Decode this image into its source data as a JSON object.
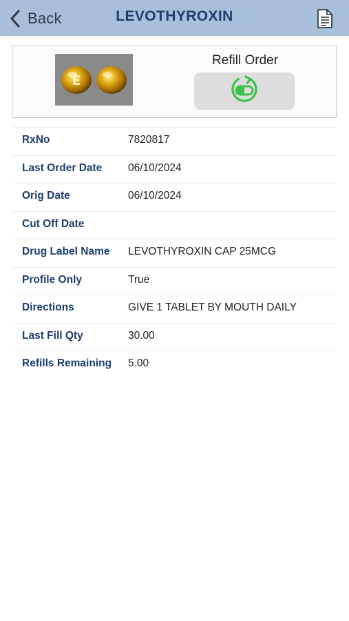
{
  "nav": {
    "back_label": "Back",
    "title": "LEVOTHYROXIN",
    "doc_icon": "document-icon"
  },
  "card": {
    "pill_image_icon": "pill-photo",
    "pill_imprint": "E",
    "refill_title": "Refill Order",
    "refill_icon": "refill-capsule-icon"
  },
  "details": [
    {
      "label": "RxNo",
      "value": "7820817"
    },
    {
      "label": "Last Order Date",
      "value": "06/10/2024"
    },
    {
      "label": "Orig Date",
      "value": "06/10/2024"
    },
    {
      "label": "Cut Off Date",
      "value": ""
    },
    {
      "label": "Drug Label Name",
      "value": "LEVOTHYROXIN CAP 25MCG"
    },
    {
      "label": "Profile Only",
      "value": "True"
    },
    {
      "label": "Directions",
      "value": "GIVE 1 TABLET BY MOUTH DAILY"
    },
    {
      "label": "Last Fill Qty",
      "value": "30.00"
    },
    {
      "label": "Refills Remaining",
      "value": "5.00"
    }
  ],
  "colors": {
    "nav_background": "#a8bfdb",
    "title_color": "#1d3d6b",
    "refill_icon_color": "#3cc24a"
  }
}
